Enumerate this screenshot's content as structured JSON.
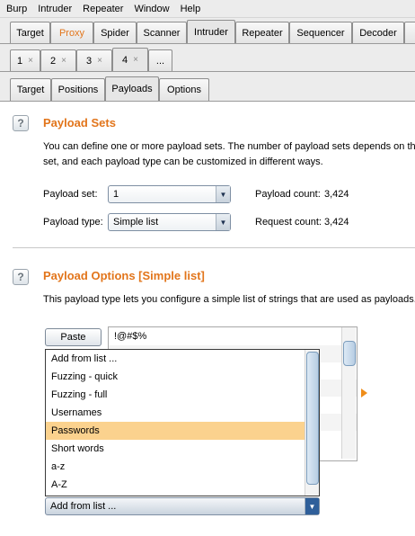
{
  "menu": [
    "Burp",
    "Intruder",
    "Repeater",
    "Window",
    "Help"
  ],
  "main_tabs": [
    {
      "label": "Target"
    },
    {
      "label": "Proxy",
      "highlight": "#e2751b"
    },
    {
      "label": "Spider"
    },
    {
      "label": "Scanner"
    },
    {
      "label": "Intruder",
      "active": true
    },
    {
      "label": "Repeater"
    },
    {
      "label": "Sequencer"
    },
    {
      "label": "Decoder"
    }
  ],
  "attack_tabs": [
    {
      "label": "1",
      "close": "×"
    },
    {
      "label": "2",
      "close": "×"
    },
    {
      "label": "3",
      "close": "×"
    },
    {
      "label": "4",
      "close": "×",
      "active": true
    },
    {
      "label": "..."
    }
  ],
  "sub_tabs": [
    {
      "label": "Target"
    },
    {
      "label": "Positions"
    },
    {
      "label": "Payloads",
      "active": true
    },
    {
      "label": "Options"
    }
  ],
  "payload_sets": {
    "title": "Payload Sets",
    "help": "?",
    "desc_line1": "You can define one or more payload sets. The number of payload sets depends on the",
    "desc_line2": "set, and each payload type can be customized in different ways.",
    "set_label": "Payload set:",
    "set_value": "1",
    "type_label": "Payload type:",
    "type_value": "Simple list",
    "payload_count_label": "Payload count:",
    "payload_count": "3,424",
    "request_count_label": "Request count:",
    "request_count": "3,424"
  },
  "payload_options": {
    "title": "Payload Options [Simple list]",
    "help": "?",
    "desc": "This payload type lets you configure a simple list of strings that are used as payloads.",
    "paste_label": "Paste",
    "list_first_value": "!@#$%",
    "dropdown_items": [
      "Add from list ...",
      "Fuzzing - quick",
      "Fuzzing - full",
      "Usernames",
      "Passwords",
      "Short words",
      "a-z",
      "A-Z"
    ],
    "selected_item": "Passwords",
    "combo_value": "Add from list ..."
  },
  "colors": {
    "accent": "#e2751b",
    "selection": "#fbd28e",
    "arrow": "#ef8d1a"
  }
}
